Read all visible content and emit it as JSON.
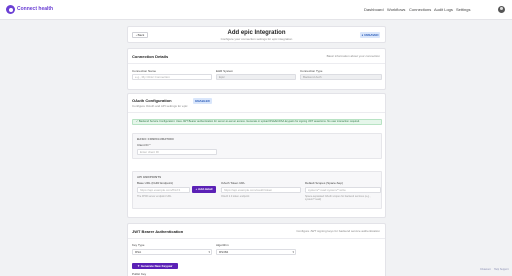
{
  "nav": {
    "brand": "Connect health",
    "links": [
      "Dashboard",
      "Workflows",
      "Connections",
      "Audit Logs",
      "Settings"
    ]
  },
  "header": {
    "back": "Back",
    "title": "Add epic Integration",
    "subtitle": "Configure your connection settings for epic integration",
    "status": "UNSAVED"
  },
  "connection": {
    "title": "Connection Details",
    "right": "Basic information about your connection",
    "name_label": "Connection Name",
    "name_placeholder": "e.g., My Clinic Connection",
    "ehr_label": "EHR System",
    "ehr_value": "Epic",
    "type_label": "Connection Type",
    "type_value": "Backend Auth"
  },
  "oauth": {
    "title": "OAuth Configuration",
    "subtitle": "Configure OAuth and API settings for epic",
    "badge": "ENABLED",
    "alert": "✓ Backend Service Configuration: Uses JWT Bearer authentication for server-to-server access. Generate or upload RSA/ECDSA keypairs for signing JWT assertions. No user interaction required.",
    "basic_title": "BASIC CONFIGURATION",
    "client_id_label": "Client ID *",
    "client_id_placeholder": "Enter client ID",
    "endpoints_title": "API ENDPOINTS",
    "base_url_label": "Base URL (FHIR Endpoint)",
    "base_url_placeholder": "https://api.example.com/fhir/r4",
    "base_url_hint": "The FHIR server endpoint URL",
    "add_label": "+ Add detail",
    "token_label": "OAuth Token URL",
    "token_placeholder": "https://api.example.com/oauth/token",
    "token_hint": "OAuth 2.0 token endpoint",
    "scopes_label": "Default Scopes (Space-Sep)",
    "scopes_placeholder": "system/*.read system/*.write",
    "scopes_hint": "Space-separated OAuth scopes for backend services (e.g., system/*.read)"
  },
  "jwt": {
    "title": "JWT Bearer Authentication",
    "right": "Configure JWT signing keys for backend service authentication",
    "key_type_label": "Key Type",
    "key_type_value": "RSA",
    "algorithm_label": "Algorithm",
    "algorithm_value": "RS384",
    "generate_label": "✦ Generate New Keypair",
    "public_label": "Public Key"
  },
  "footer": {
    "left": "Chatwoot",
    "right": "Help Support"
  }
}
